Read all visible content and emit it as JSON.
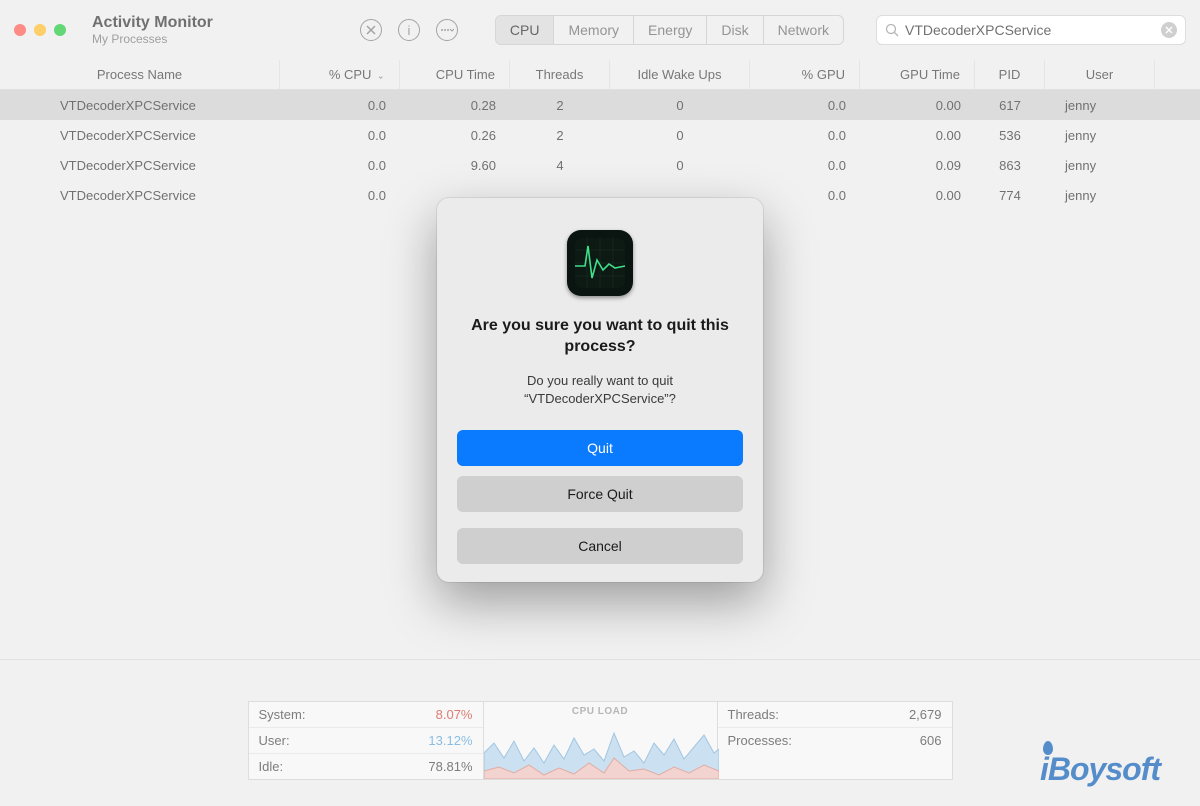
{
  "header": {
    "title": "Activity Monitor",
    "subtitle": "My Processes"
  },
  "tabs": [
    "CPU",
    "Memory",
    "Energy",
    "Disk",
    "Network"
  ],
  "search": {
    "value": "VTDecoderXPCService"
  },
  "columns": {
    "name": "Process Name",
    "cpu": "% CPU",
    "cputime": "CPU Time",
    "threads": "Threads",
    "idle": "Idle Wake Ups",
    "gpu": "% GPU",
    "gputime": "GPU Time",
    "pid": "PID",
    "user": "User"
  },
  "rows": [
    {
      "name": "VTDecoderXPCService",
      "cpu": "0.0",
      "cputime": "0.28",
      "threads": "2",
      "idle": "0",
      "gpu": "0.0",
      "gputime": "0.00",
      "pid": "617",
      "user": "jenny"
    },
    {
      "name": "VTDecoderXPCService",
      "cpu": "0.0",
      "cputime": "0.26",
      "threads": "2",
      "idle": "0",
      "gpu": "0.0",
      "gputime": "0.00",
      "pid": "536",
      "user": "jenny"
    },
    {
      "name": "VTDecoderXPCService",
      "cpu": "0.0",
      "cputime": "9.60",
      "threads": "4",
      "idle": "0",
      "gpu": "0.0",
      "gputime": "0.09",
      "pid": "863",
      "user": "jenny"
    },
    {
      "name": "VTDecoderXPCService",
      "cpu": "0.0",
      "cputime": "",
      "threads": "",
      "idle": "",
      "gpu": "0.0",
      "gputime": "0.00",
      "pid": "774",
      "user": "jenny"
    }
  ],
  "footer": {
    "system_label": "System:",
    "system_val": "8.07%",
    "user_label": "User:",
    "user_val": "13.12%",
    "idle_label": "Idle:",
    "idle_val": "78.81%",
    "mid_title": "CPU LOAD",
    "threads_label": "Threads:",
    "threads_val": "2,679",
    "processes_label": "Processes:",
    "processes_val": "606"
  },
  "dialog": {
    "title": "Are you sure you want to quit this process?",
    "message": "Do you really want to quit “VTDecoderXPCService”?",
    "quit": "Quit",
    "force": "Force Quit",
    "cancel": "Cancel"
  },
  "logo": "iBoysoft"
}
